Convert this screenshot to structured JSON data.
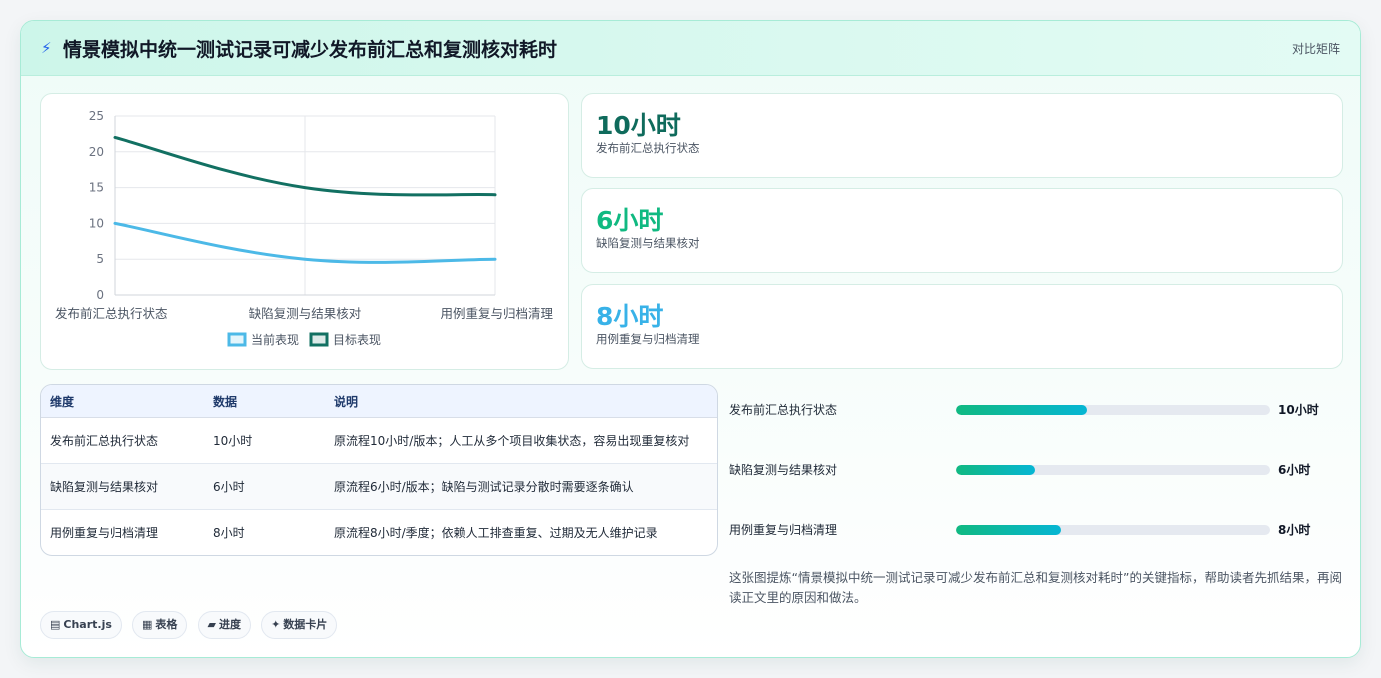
{
  "header": {
    "icon": "bolt-icon",
    "title": "情景模拟中统一测试记录可减少发布前汇总和复测核对耗时",
    "tag": "对比矩阵"
  },
  "chart_data": {
    "type": "line",
    "categories": [
      "发布前汇总执行状态",
      "缺陷复测与结果核对",
      "用例重复与归档清理"
    ],
    "series": [
      {
        "name": "当前表现",
        "values": [
          10,
          5,
          5
        ],
        "color": "#4cb9e7"
      },
      {
        "name": "目标表现",
        "values": [
          22,
          15,
          14
        ],
        "color": "#127062"
      }
    ],
    "yticks": [
      "0",
      "5",
      "10",
      "15",
      "20",
      "25"
    ],
    "ylim": [
      0,
      25
    ],
    "grid": true,
    "legend": "bottom"
  },
  "metrics": [
    {
      "value": "10小时",
      "label": "发布前汇总执行状态",
      "color": "#0f6b5c"
    },
    {
      "value": "6小时",
      "label": "缺陷复测与结果核对",
      "color": "#10b981"
    },
    {
      "value": "8小时",
      "label": "用例重复与归档清理",
      "color": "#38b2e8"
    }
  ],
  "table": {
    "headers": [
      "维度",
      "数据",
      "说明"
    ],
    "rows": [
      [
        "发布前汇总执行状态",
        "10小时",
        "原流程10小时/版本；人工从多个项目收集状态，容易出现重复核对"
      ],
      [
        "缺陷复测与结果核对",
        "6小时",
        "原流程6小时/版本；缺陷与测试记录分散时需要逐条确认"
      ],
      [
        "用例重复与归档清理",
        "8小时",
        "原流程8小时/季度；依赖人工排查重复、过期及无人维护记录"
      ]
    ]
  },
  "progress": [
    {
      "label": "发布前汇总执行状态",
      "value": "10小时",
      "fraction": 0.417
    },
    {
      "label": "缺陷复测与结果核对",
      "value": "6小时",
      "fraction": 0.25
    },
    {
      "label": "用例重复与归档清理",
      "value": "8小时",
      "fraction": 0.333
    }
  ],
  "note": "这张图提炼“情景模拟中统一测试记录可减少发布前汇总和复测核对耗时”的关键指标，帮助读者先抓结果，再阅读正文里的原因和做法。",
  "chips": [
    {
      "icon": "▤",
      "label": "Chart.js"
    },
    {
      "icon": "▦",
      "label": "表格"
    },
    {
      "icon": "▰",
      "label": "进度"
    },
    {
      "icon": "✦",
      "label": "数据卡片"
    }
  ]
}
